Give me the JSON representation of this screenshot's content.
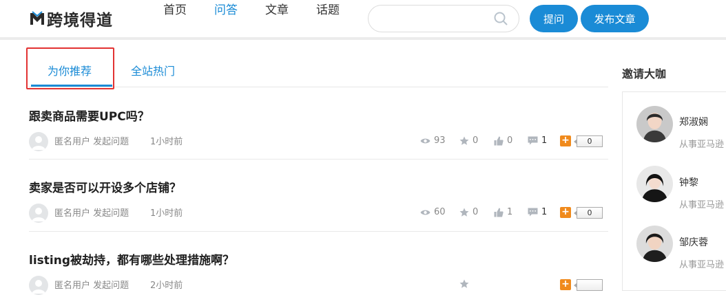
{
  "header": {
    "logo_text": "跨境得道",
    "nav": [
      {
        "label": "首页",
        "active": false
      },
      {
        "label": "问答",
        "active": true
      },
      {
        "label": "文章",
        "active": false
      },
      {
        "label": "话题",
        "active": false
      }
    ],
    "search": {
      "placeholder": "",
      "icon": "search-icon"
    },
    "ask_label": "提问",
    "publish_label": "发布文章",
    "accent_color": "#1a8bd6"
  },
  "tabs": [
    {
      "label": "为你推荐",
      "active": true
    },
    {
      "label": "全站热门",
      "active": false
    }
  ],
  "questions": [
    {
      "title": "跟卖商品需要UPC吗？",
      "user": "匿名用户 发起问题",
      "time": "1小时前",
      "views": "93",
      "stars": "0",
      "likes": "0",
      "comments": "1",
      "score": "0"
    },
    {
      "title": "卖家是否可以开设多个店铺？",
      "user": "匿名用户 发起问题",
      "time": "1小时前",
      "views": "60",
      "stars": "0",
      "likes": "1",
      "comments": "1",
      "score": "0"
    },
    {
      "title": "listing被劫持，都有哪些处理措施啊？",
      "user": "匿名用户 发起问题",
      "time": "2小时前",
      "views": "",
      "stars": "",
      "likes": "",
      "comments": "",
      "score": ""
    }
  ],
  "sidebar": {
    "title": "邀请大咖",
    "experts": [
      {
        "name": "郑淑娴",
        "desc": "从事亚马逊"
      },
      {
        "name": "钟黎",
        "desc": "从事亚马逊"
      },
      {
        "name": "邹庆蓉",
        "desc": "从事亚马逊"
      }
    ]
  }
}
